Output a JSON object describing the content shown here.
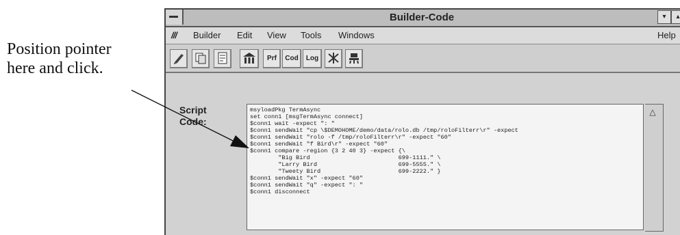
{
  "annotation": {
    "line1": "Position pointer",
    "line2": "here and click."
  },
  "window": {
    "title": "Builder-Code",
    "minimize_glyph": "▾",
    "maximize_glyph": "▴"
  },
  "menu": {
    "app_icon_text": "///",
    "items": [
      "Builder",
      "Edit",
      "View",
      "Tools",
      "Windows"
    ],
    "help": "Help"
  },
  "toolbar": {
    "buttons": [
      {
        "icon": "pencil-icon"
      },
      {
        "icon": "copy-icon"
      },
      {
        "icon": "document-icon"
      },
      {
        "icon": "building-icon"
      },
      {
        "label": "Prf"
      },
      {
        "label": "Cod"
      },
      {
        "label": "Log"
      },
      {
        "icon": "tool-icon"
      },
      {
        "icon": "person-icon"
      }
    ]
  },
  "script": {
    "label_line1": "Script",
    "label_line2": "Code:",
    "lines": [
      "msyloadPkg TermAsync",
      "set conn1 [msgTermAsync connect]",
      "$conn1 wait -expect \": \"",
      "$conn1 sendWait \"cp \\$DEMOHOME/demo/data/rolo.db /tmp/roloFilterr\\r\" -expect",
      "$conn1 sendWait \"rolo -f /tmp/roloFilterr\\r\" -expect \"60\"",
      "$conn1 sendWait \"f Bird\\r\" -expect \"60\"",
      "$conn1 compare -region {3 2 40 3} -expect {\\",
      "        \"Big Bird                         699-1111.\" \\",
      "        \"Larry Bird                       699-5555.\" \\",
      "        \"Tweety Bird                      699-2222.\" }",
      "$conn1 sendWait \"x\" -expect \"60\"",
      "$conn1 sendWait \"q\" -expect \": \"",
      "$conn1 disconnect"
    ]
  }
}
